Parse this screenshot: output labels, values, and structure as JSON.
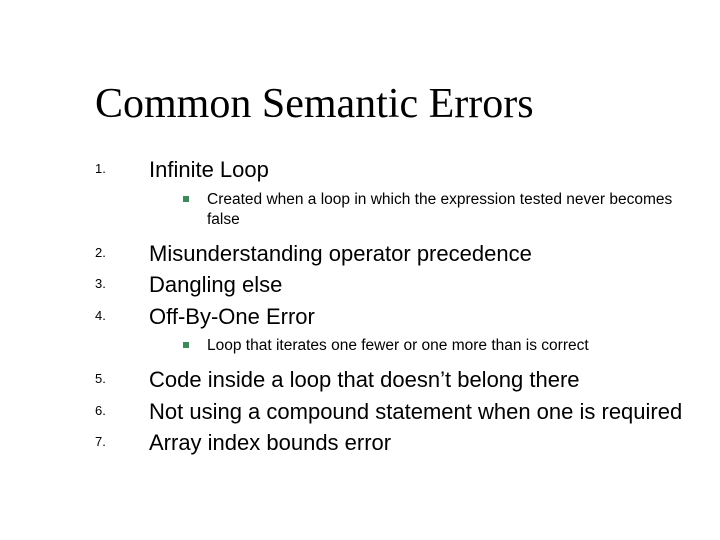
{
  "title": "Common Semantic Errors",
  "items": [
    {
      "num": "1.",
      "text": "Infinite Loop",
      "sub": [
        "Created when a loop in which the expression tested never becomes false"
      ]
    },
    {
      "num": "2.",
      "text": "Misunderstanding operator precedence"
    },
    {
      "num": "3.",
      "text": "Dangling else"
    },
    {
      "num": "4.",
      "text": "Off-By-One Error",
      "sub": [
        "Loop that iterates one fewer or one more than is correct"
      ]
    },
    {
      "num": "5.",
      "text": "Code inside a loop that doesn’t belong there"
    },
    {
      "num": "6.",
      "text": "Not using a compound statement when one is required"
    },
    {
      "num": "7.",
      "text": "Array index bounds error"
    }
  ]
}
